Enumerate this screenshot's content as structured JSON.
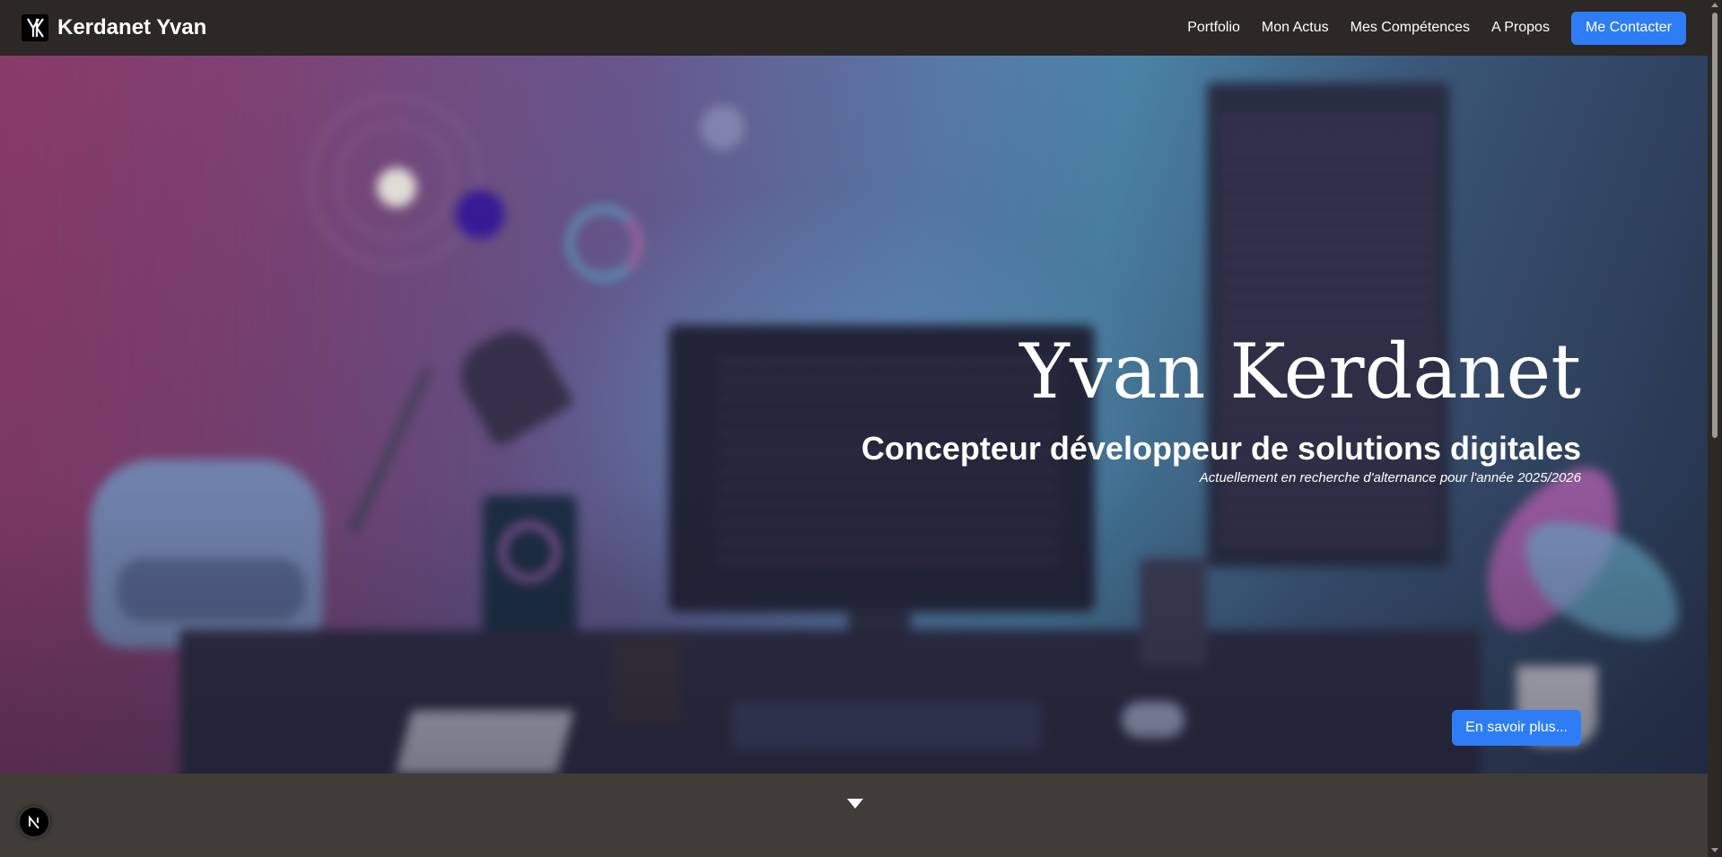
{
  "navbar": {
    "brand_title": "Kerdanet Yvan",
    "brand_logo_icon": "yk-monogram-logo",
    "links": [
      {
        "label": "Portfolio"
      },
      {
        "label": "Mon Actus"
      },
      {
        "label": "Mes Compétences"
      },
      {
        "label": "A Propos"
      }
    ],
    "contact_label": "Me Contacter"
  },
  "hero": {
    "name": "Yvan Kerdanet",
    "subtitle": "Concepteur développeur de solutions digitales",
    "note": "Actuellement en recherche d'alternance pour l'année 2025/2026",
    "cta_label": "En savoir plus...",
    "background": "blurred-desk-illustration"
  },
  "footer_hint": {
    "arrow_icon": "caret-down-icon",
    "badge_icon": "nextjs-logo-icon"
  },
  "colors": {
    "nav_bg": "#2b2826",
    "accent": "#2f7df6",
    "band_bg": "#403c37"
  }
}
